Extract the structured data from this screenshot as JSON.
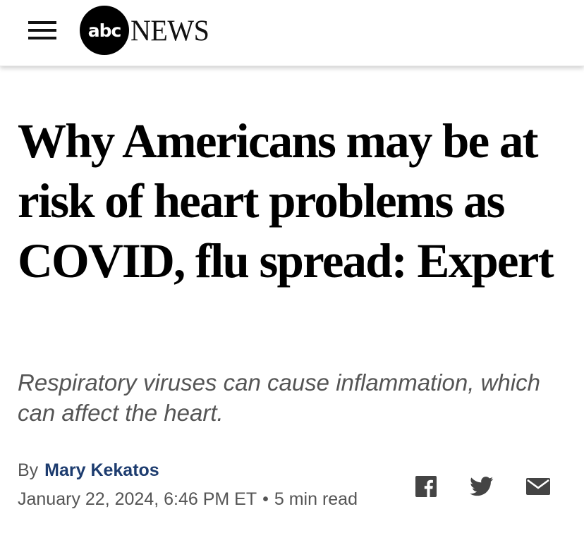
{
  "header": {
    "menu_icon": "hamburger-menu-icon",
    "logo_circle_text": "abc",
    "logo_word": "NEWS"
  },
  "article": {
    "headline": "Why Americans may be at risk of heart problems as COVID, flu spread: Expert",
    "subheadline": "Respiratory viruses can cause inflammation, which can affect the heart.",
    "byline_prefix": "By",
    "author": "Mary Kekatos",
    "date": "January 22, 2024, 6:46 PM ET",
    "separator": "•",
    "read_time": "5 min read"
  },
  "share": {
    "icons": [
      "facebook-icon",
      "twitter-icon",
      "email-icon"
    ]
  },
  "colors": {
    "author_link": "#1d3c6f",
    "meta_text": "#555555",
    "icon_gray": "#444444"
  }
}
